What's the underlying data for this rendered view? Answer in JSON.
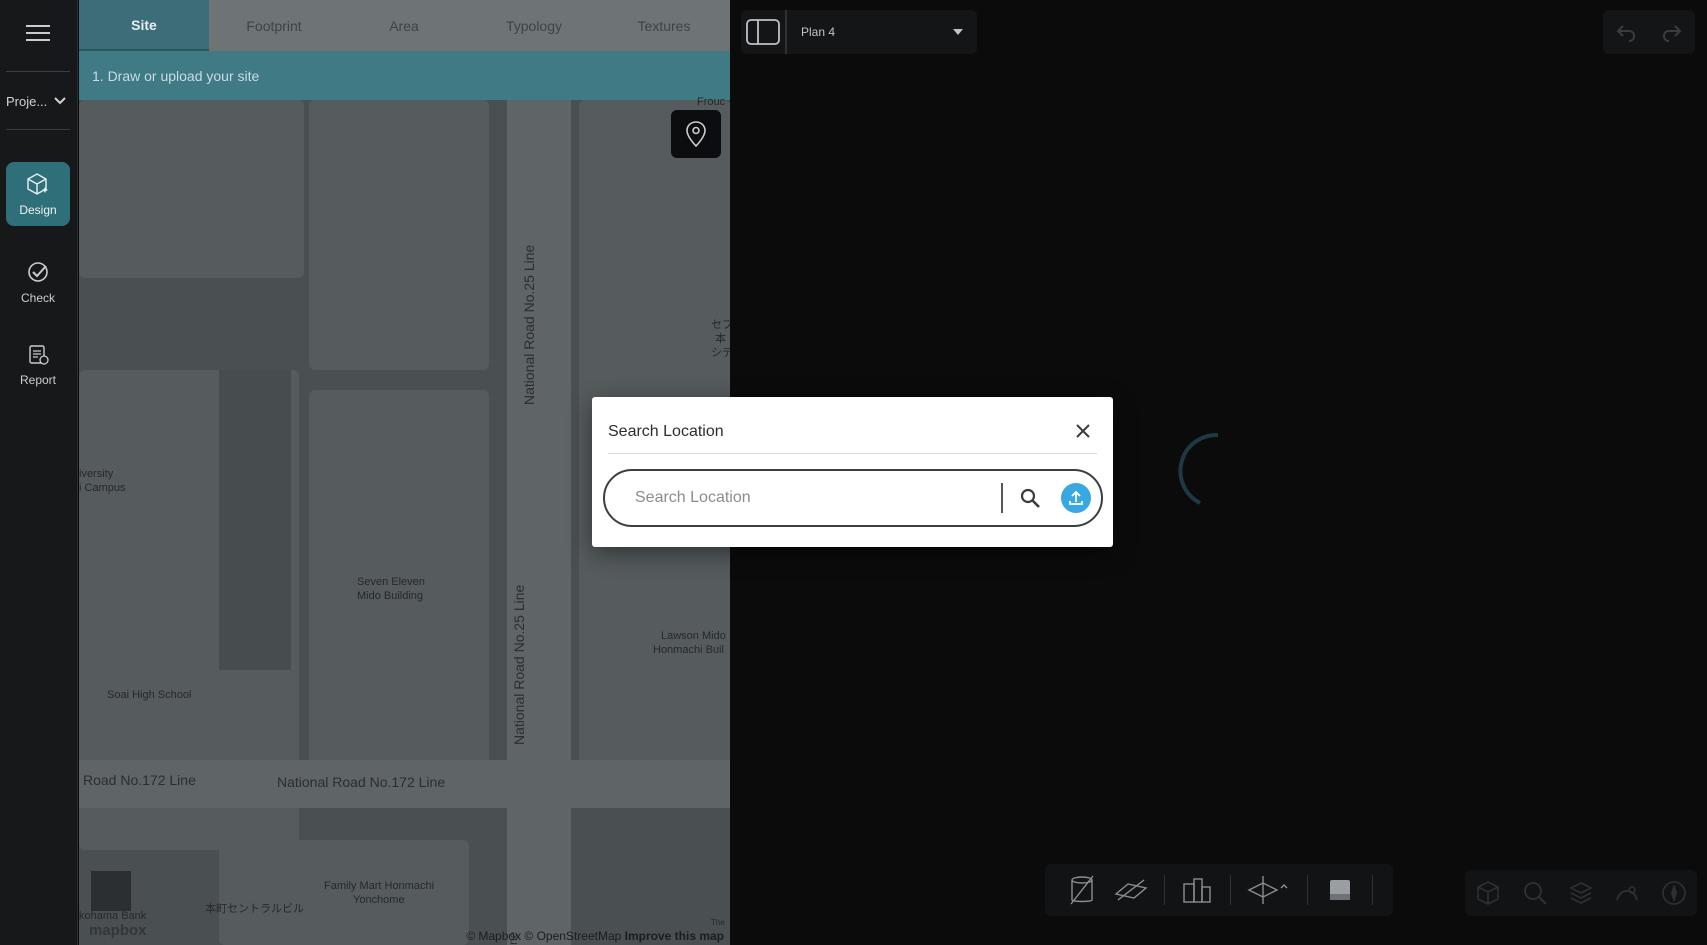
{
  "sidebar": {
    "project_label": "Proje...",
    "items": [
      {
        "label": "Design",
        "icon": "cube-sparkle-icon",
        "active": true
      },
      {
        "label": "Check",
        "icon": "check-circle-icon",
        "active": false
      },
      {
        "label": "Report",
        "icon": "report-icon",
        "active": false
      }
    ]
  },
  "tabs": [
    "Site",
    "Footprint",
    "Area",
    "Typology",
    "Textures"
  ],
  "active_tab": "Site",
  "step_instruction": "1. Draw or upload your site",
  "map": {
    "labels": {
      "university": "iversity",
      "campus": "i Campus",
      "seven_eleven_1": "Seven Eleven",
      "seven_eleven_2": "Mido Building",
      "lawson_1": "Lawson Mido",
      "lawson_2": "Honmachi Buil",
      "soai": "Soai High School",
      "family_mart_1": "Family Mart Honmachi",
      "family_mart_2": "Yonchome",
      "honmachi_jp": "本町セントラルビル",
      "yokohama_bank": "kohama Bank",
      "seven_jp_1": "セブ",
      "seven_jp_2": "本",
      "seven_jp_3": "シテ",
      "top_right_1": "Frouc",
      "bottom_the": "The"
    },
    "roads": {
      "nr25_upper": "National Road No.25 Line",
      "nr25_lower": "National Road No.25 Line",
      "nr172_left": "Road No.172 Line",
      "nr172_right": "National Road No.172 Line",
      "bottom_ne": "ne"
    },
    "logo_text": "mapbox",
    "attribution": "© Mapbox © OpenStreetMap",
    "attribution_link": "Improve this map"
  },
  "plan_selector": {
    "value": "Plan 4"
  },
  "modal": {
    "title": "Search Location",
    "search_placeholder": "Search Location",
    "search_value": ""
  },
  "colors": {
    "accent_teal": "#3d6e78",
    "upload_blue": "#3aa8e0",
    "modal_bg": "#ffffff",
    "workspace_bg": "#0b0b0c"
  }
}
